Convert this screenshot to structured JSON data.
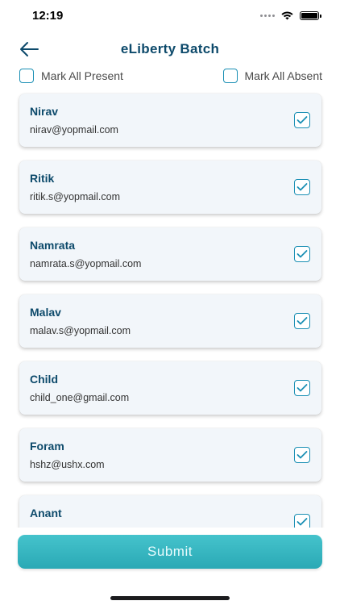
{
  "status_bar": {
    "time": "12:19",
    "icons": [
      "signal-dots-icon",
      "wifi-icon",
      "battery-icon"
    ]
  },
  "header": {
    "back_icon": "arrow-left-icon",
    "title": "eLiberty Batch"
  },
  "mark_all": {
    "present_label": "Mark All Present",
    "absent_label": "Mark All Absent",
    "present_checked": false,
    "absent_checked": false
  },
  "students": [
    {
      "name": "Nirav",
      "email": "nirav@yopmail.com",
      "checked": true
    },
    {
      "name": "Ritik",
      "email": "ritik.s@yopmail.com",
      "checked": true
    },
    {
      "name": "Namrata",
      "email": "namrata.s@yopmail.com",
      "checked": true
    },
    {
      "name": "Malav",
      "email": "malav.s@yopmail.com",
      "checked": true
    },
    {
      "name": "Child",
      "email": "child_one@gmail.com",
      "checked": true
    },
    {
      "name": "Foram",
      "email": "hshz@ushx.com",
      "checked": true
    },
    {
      "name": "Anant",
      "email": "",
      "checked": true
    }
  ],
  "submit_label": "Submit",
  "colors": {
    "accent": "#1a8fb4",
    "title": "#0d4a6b",
    "card_bg": "#f2f6fa",
    "submit_top": "#45c3cc",
    "submit_bottom": "#2aa9b5"
  }
}
